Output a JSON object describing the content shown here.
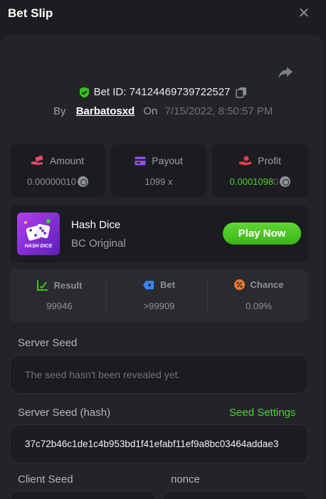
{
  "header": {
    "title": "Bet Slip",
    "close_icon": "close-icon"
  },
  "bet": {
    "id_label": "Bet ID: 74124469739722527",
    "by_label": "By",
    "user": "Barbatosxd",
    "on_label": "On",
    "date": "7/15/2022, 8:50:57 PM"
  },
  "stats": {
    "amount": {
      "label": "Amount",
      "value": "0.00000010",
      "icon": "money-hand-icon"
    },
    "payout": {
      "label": "Payout",
      "value": "1099 x",
      "icon": "card-icon"
    },
    "profit": {
      "label": "Profit",
      "value_main": "0.0001098",
      "value_dim": "0",
      "icon": "hand-coin-icon"
    }
  },
  "game": {
    "name": "Hash Dice",
    "subtitle": "BC Original",
    "thumb_text": "HASH DICE",
    "play_label": "Play Now"
  },
  "result": {
    "result": {
      "label": "Result",
      "value": "99946"
    },
    "bet": {
      "label": "Bet",
      "value": ">99909"
    },
    "chance": {
      "label": "Chance",
      "value": "0.09%"
    }
  },
  "seeds": {
    "server_seed_label": "Server Seed",
    "server_seed_value": "The seed hasn't been revealed yet.",
    "server_hash_label": "Server Seed (hash)",
    "seed_settings_label": "Seed Settings",
    "server_hash_value": "37c72b46c1de1c4b953bd1f41efabf11ef9a8bc03464addae3",
    "client_seed_label": "Client Seed",
    "nonce_label": "nonce"
  },
  "colors": {
    "accent_green": "#4fd134",
    "background": "#1c1d20",
    "panel": "#232428",
    "card": "#1b1c1f"
  }
}
